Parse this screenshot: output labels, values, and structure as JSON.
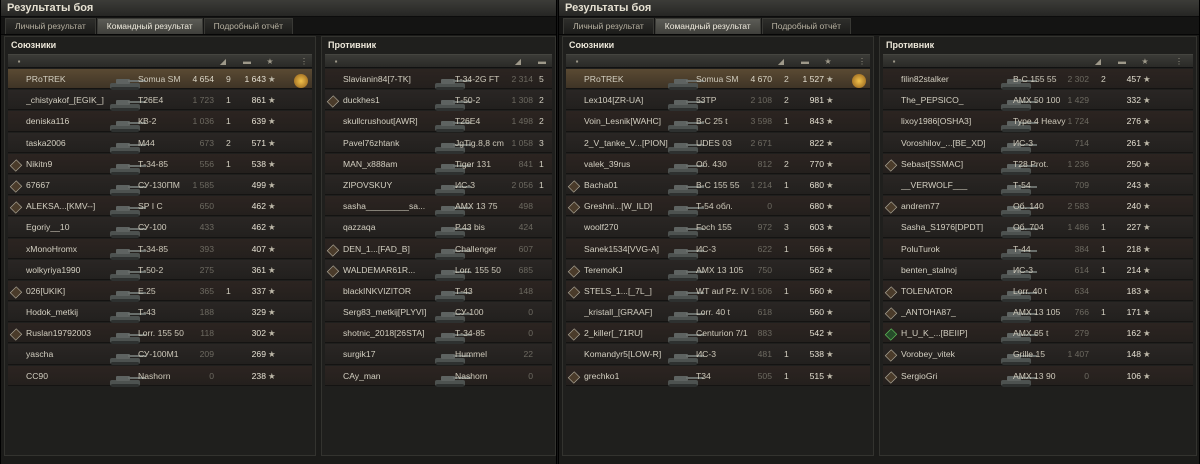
{
  "windows": [
    {
      "title": "Результаты боя",
      "tabs": [
        "Личный результат",
        "Командный результат",
        "Подробный отчёт"
      ],
      "allies": {
        "heading": "Союзники",
        "rows": [
          {
            "player": "PRoTREK",
            "tank": "Somua SM",
            "damage": "4 654",
            "kills": "9",
            "xp": "1 643",
            "me": true,
            "medal": true
          },
          {
            "player": "_chistyakof_[EGIK_]",
            "tank": "T26E4",
            "damage": "1 723",
            "kills": "1",
            "xp": "861"
          },
          {
            "player": "deniska116",
            "tank": "КВ-2",
            "damage": "1 036",
            "kills": "1",
            "xp": "639"
          },
          {
            "player": "taska2006",
            "tank": "M44",
            "damage": "673",
            "kills": "2",
            "xp": "571"
          },
          {
            "player": "Nikitn9",
            "tank": "Т-34-85",
            "damage": "556",
            "kills": "1",
            "xp": "538",
            "badge": true
          },
          {
            "player": "67667",
            "tank": "СУ-130ПМ",
            "damage": "1 585",
            "kills": "",
            "xp": "499",
            "badge": true
          },
          {
            "player": "ALEKSA...[KMV--]",
            "tank": "SP I C",
            "damage": "650",
            "kills": "",
            "xp": "462",
            "badge": true
          },
          {
            "player": "Egoriy__10",
            "tank": "СУ-100",
            "damage": "433",
            "kills": "",
            "xp": "462"
          },
          {
            "player": "xMonoHromx",
            "tank": "Т-34-85",
            "damage": "393",
            "kills": "",
            "xp": "407"
          },
          {
            "player": "wolkyriya1990",
            "tank": "Т-50-2",
            "damage": "275",
            "kills": "",
            "xp": "361"
          },
          {
            "player": "026[UKIK]",
            "tank": "E 25",
            "damage": "365",
            "kills": "1",
            "xp": "337",
            "badge": true
          },
          {
            "player": "Hodok_metkij",
            "tank": "Т-43",
            "damage": "188",
            "kills": "",
            "xp": "329"
          },
          {
            "player": "Ruslan19792003",
            "tank": "Lorr. 155 50",
            "damage": "118",
            "kills": "",
            "xp": "302",
            "badge": true
          },
          {
            "player": "yascha",
            "tank": "СУ-100М1",
            "damage": "209",
            "kills": "",
            "xp": "269"
          },
          {
            "player": "CC90",
            "tank": "Nashorn",
            "damage": "0",
            "kills": "",
            "xp": "238"
          }
        ]
      },
      "enemies": {
        "heading": "Противник",
        "rows": [
          {
            "player": "Slavianin84[7-TK]",
            "tank": "T-34-2G FT",
            "damage": "2 314",
            "kills": "5"
          },
          {
            "player": "duckhes1",
            "tank": "Т-50-2",
            "damage": "1 308",
            "kills": "2",
            "badge": true
          },
          {
            "player": "skullcrushout[AWR]",
            "tank": "T26E4",
            "damage": "1 498",
            "kills": "2"
          },
          {
            "player": "Pavel76zhtank",
            "tank": "JgTig.8,8 cm",
            "damage": "1 058",
            "kills": "3"
          },
          {
            "player": "MAN_x888am",
            "tank": "Tiger 131",
            "damage": "841",
            "kills": "1"
          },
          {
            "player": "ZIPOVSKUY",
            "tank": "ИС-3",
            "damage": "2 056",
            "kills": "1"
          },
          {
            "player": "sasha_________sa...",
            "tank": "AMX 13 75",
            "damage": "498",
            "kills": ""
          },
          {
            "player": "qazzaqa",
            "tank": "P.43 bis",
            "damage": "424",
            "kills": ""
          },
          {
            "player": "DEN_1...[FAD_B]",
            "tank": "Challenger",
            "damage": "607",
            "kills": "",
            "badge": true
          },
          {
            "player": "WALDEMAR61R...",
            "tank": "Lorr. 155 50",
            "damage": "685",
            "kills": "",
            "badge": true
          },
          {
            "player": "blackINKVIZITOR",
            "tank": "Т-43",
            "damage": "148",
            "kills": ""
          },
          {
            "player": "Serg83_metkij[PLYVI]",
            "tank": "СУ-100",
            "damage": "0",
            "kills": ""
          },
          {
            "player": "shotnic_2018[26STA]",
            "tank": "Т-34-85",
            "damage": "0",
            "kills": ""
          },
          {
            "player": "surgik17",
            "tank": "Hummel",
            "damage": "22",
            "kills": ""
          },
          {
            "player": "CAy_man",
            "tank": "Nashorn",
            "damage": "0",
            "kills": ""
          }
        ]
      }
    },
    {
      "title": "Результаты боя",
      "tabs": [
        "Личный результат",
        "Командный результат",
        "Подробный отчёт"
      ],
      "allies": {
        "heading": "Союзники",
        "rows": [
          {
            "player": "PRoTREK",
            "tank": "Somua SM",
            "damage": "4 670",
            "kills": "2",
            "xp": "1 527",
            "me": true,
            "medal": true
          },
          {
            "player": "Lex104[ZR-UA]",
            "tank": "53TP",
            "damage": "2 108",
            "kills": "2",
            "xp": "981"
          },
          {
            "player": "Voin_Lesnik[WAHC]",
            "tank": "B-C 25 t",
            "damage": "3 598",
            "kills": "1",
            "xp": "843"
          },
          {
            "player": "2_V_tanke_V...[PION]",
            "tank": "UDES 03",
            "damage": "2 671",
            "kills": "",
            "xp": "822"
          },
          {
            "player": "valek_39rus",
            "tank": "Об. 430",
            "damage": "812",
            "kills": "2",
            "xp": "770"
          },
          {
            "player": "Bacha01",
            "tank": "B-C 155 55",
            "damage": "1 214",
            "kills": "1",
            "xp": "680",
            "badge": true
          },
          {
            "player": "Greshni...[W_ILD]",
            "tank": "Т-54 обл.",
            "damage": "0",
            "kills": "",
            "xp": "680",
            "badge": true
          },
          {
            "player": "woolf270",
            "tank": "Foch 155",
            "damage": "972",
            "kills": "3",
            "xp": "603"
          },
          {
            "player": "Sanek1534[VVG-A]",
            "tank": "ИС-3",
            "damage": "622",
            "kills": "1",
            "xp": "566"
          },
          {
            "player": "TeremoKJ",
            "tank": "AMX 13 105",
            "damage": "750",
            "kills": "",
            "xp": "562",
            "badge": true
          },
          {
            "player": "STELS_1...[_7L_]",
            "tank": "WT auf Pz. IV",
            "damage": "1 506",
            "kills": "1",
            "xp": "560",
            "badge": true
          },
          {
            "player": "_kristall_[GRAAF]",
            "tank": "Lorr. 40 t",
            "damage": "618",
            "kills": "",
            "xp": "560"
          },
          {
            "player": "2_killer[_71RU]",
            "tank": "Centurion 7/1",
            "damage": "883",
            "kills": "",
            "xp": "542",
            "badge": true
          },
          {
            "player": "Komandyr5[LOW-R]",
            "tank": "ИС-3",
            "damage": "481",
            "kills": "1",
            "xp": "538"
          },
          {
            "player": "grechko1",
            "tank": "T34",
            "damage": "505",
            "kills": "1",
            "xp": "515",
            "badge": true
          }
        ]
      },
      "enemies": {
        "heading": "Противник",
        "rows": [
          {
            "player": "filin82stalker",
            "tank": "B-C 155 55",
            "damage": "2 302",
            "kills": "2",
            "xp": "457"
          },
          {
            "player": "The_PEPSICO_",
            "tank": "AMX 50 100",
            "damage": "1 429",
            "kills": "",
            "xp": "332"
          },
          {
            "player": "lixoy1986[OSHA3]",
            "tank": "Type 4 Heavy",
            "damage": "1 724",
            "kills": "",
            "xp": "276"
          },
          {
            "player": "Voroshilov_...[BE_XD]",
            "tank": "ИС-3",
            "damage": "714",
            "kills": "",
            "xp": "261"
          },
          {
            "player": "Sebast[SSMAC]",
            "tank": "T28 Prot.",
            "damage": "1 236",
            "kills": "",
            "xp": "250",
            "badge": true
          },
          {
            "player": "__VERWOLF___",
            "tank": "Т-54",
            "damage": "709",
            "kills": "",
            "xp": "243"
          },
          {
            "player": "andrem77",
            "tank": "Об. 140",
            "damage": "2 583",
            "kills": "",
            "xp": "240",
            "badge": true
          },
          {
            "player": "Sasha_S1976[DPDT]",
            "tank": "Об. 704",
            "damage": "1 486",
            "kills": "1",
            "xp": "227"
          },
          {
            "player": "PoluTurok",
            "tank": "Т-44",
            "damage": "384",
            "kills": "1",
            "xp": "218"
          },
          {
            "player": "benten_stalnoj",
            "tank": "ИС-3",
            "damage": "614",
            "kills": "1",
            "xp": "214"
          },
          {
            "player": "TOLENATOR",
            "tank": "Lorr. 40 t",
            "damage": "634",
            "kills": "",
            "xp": "183",
            "badge": true
          },
          {
            "player": "_ANTOHA87_",
            "tank": "AMX 13 105",
            "damage": "766",
            "kills": "1",
            "xp": "171",
            "badge": true
          },
          {
            "player": "H_U_K_...[BEIIP]",
            "tank": "AMX 65 t",
            "damage": "279",
            "kills": "",
            "xp": "162",
            "badge": true,
            "green": true
          },
          {
            "player": "Vorobey_vitek",
            "tank": "Grille 15",
            "damage": "1 407",
            "kills": "",
            "xp": "148",
            "badge": true
          },
          {
            "player": "SergioGri",
            "tank": "AMX 13 90",
            "damage": "0",
            "kills": "",
            "xp": "106",
            "badge": true
          }
        ]
      }
    }
  ],
  "icons": {
    "header_cols": [
      "vehicle-type-icon",
      "tank-icon",
      "damage-icon",
      "kills-tank-icon",
      "xp-star-icon",
      "medal-icon"
    ],
    "star": "★"
  }
}
